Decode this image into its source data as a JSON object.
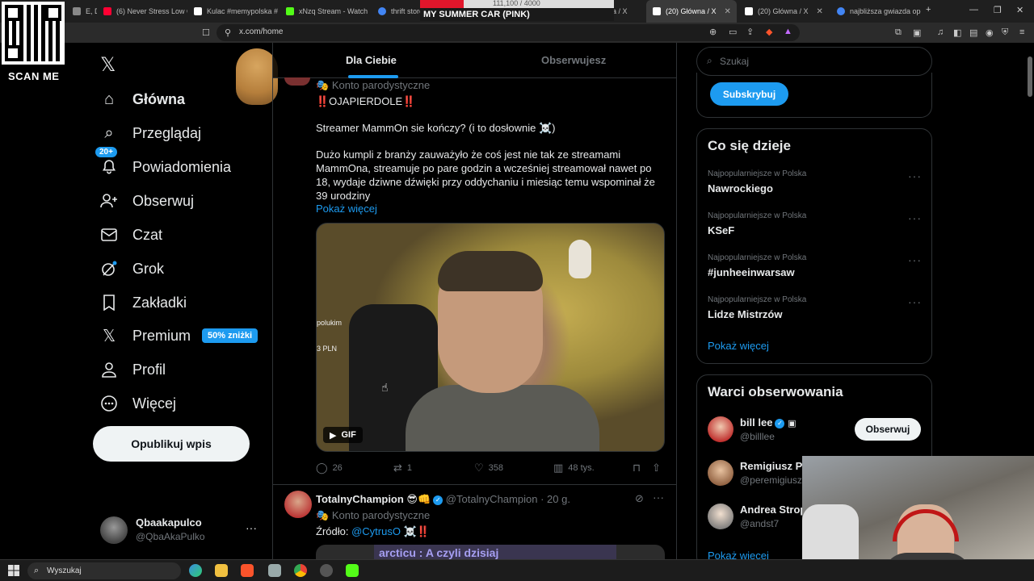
{
  "browser": {
    "tabs": [
      {
        "label": "E, D-",
        "color": "#888888"
      },
      {
        "label": "(6) Never Stress Low C",
        "color": "#ff0033"
      },
      {
        "label": "Kulac #memypolska #",
        "color": "#ffffff"
      },
      {
        "label": "xNzq Stream - Watch",
        "color": "#53fc18"
      },
      {
        "label": "thrift stores",
        "color": "#4285f4"
      },
      {
        "label": "(20) Główna / X",
        "color": "#ffffff"
      },
      {
        "label": "(20) Główna / X",
        "color": "#ffffff"
      },
      {
        "label": "(20) Główna / X",
        "color": "#ffffff"
      },
      {
        "label": "najbliższa gwiazda ope",
        "color": "#4285f4"
      }
    ],
    "new_tab": "+",
    "url": "x.com/home"
  },
  "overlays": {
    "scan_me": "SCAN ME",
    "progress_text": "111,100 / 4000",
    "stream_title": "MY SUMMER CAR (PINK)"
  },
  "nav": {
    "items": [
      {
        "label": "Główna",
        "icon": "home-icon",
        "glyph": "⌂"
      },
      {
        "label": "Przeglądaj",
        "icon": "search-icon",
        "glyph": "⌕"
      },
      {
        "label": "Powiadomienia",
        "icon": "bell-icon",
        "glyph": "🔔"
      },
      {
        "label": "Obserwuj",
        "icon": "add-person-icon",
        "glyph": "👤"
      },
      {
        "label": "Czat",
        "icon": "mail-icon",
        "glyph": "✉"
      },
      {
        "label": "Grok",
        "icon": "grok-icon",
        "glyph": "⊘"
      },
      {
        "label": "Zakładki",
        "icon": "bookmark-icon",
        "glyph": "🔖"
      },
      {
        "label": "Premium",
        "icon": "x-logo-icon",
        "glyph": "𝕏"
      },
      {
        "label": "Profil",
        "icon": "person-icon",
        "glyph": "👤"
      },
      {
        "label": "Więcej",
        "icon": "more-circle-icon",
        "glyph": "⋯"
      }
    ],
    "notif_badge": "20+",
    "premium_badge": "50% zniżki",
    "post_button": "Opublikuj wpis",
    "account": {
      "name": "Qbaakapulco",
      "handle": "@QbaAkaPulko",
      "more": "···"
    }
  },
  "timeline": {
    "tab_for_you": "Dla Ciebie",
    "tab_following": "Obserwujesz",
    "post1": {
      "parody_label": "Konto parodystyczne",
      "line1": "‼️OJAPIERDOLE‼️",
      "line2": "Streamer MammOn sie kończy? (i to dosłownie ☠️)",
      "body": "Dużo kumpli z branży zauważyło że coś jest nie tak ze streamami MammOna, streamuje po pare godzin a wcześniej streamował nawet po 18, wydaje dziwne dźwięki przy oddychaniu i miesiąc temu wspominał że 39 urodziny",
      "show_more": "Pokaż więcej",
      "media_overlay_1": "polukim",
      "media_overlay_2": "3 PLN",
      "gif_label": "GIF",
      "replies": "26",
      "reposts": "1",
      "likes": "358",
      "views": "48 tys."
    },
    "post2": {
      "name": "TotalnyChampion 😎👊",
      "handle": "@TotalnyChampion",
      "time": "· 20 g.",
      "parody_label": "Konto parodystyczne",
      "source_prefix": "Źródło: ",
      "source_link": "@CytrusO",
      "source_suffix": " ☠️‼️",
      "preview_text": "arcticu  : A czyli dzisiaj"
    }
  },
  "sidebar": {
    "search_placeholder": "Szukaj",
    "subscribe": "Subskrybuj",
    "trends_title": "Co się dzieje",
    "trends": [
      {
        "meta": "Najpopularniejsze w Polska",
        "name": "Nawrockiego"
      },
      {
        "meta": "Najpopularniejsze w Polska",
        "name": "KSeF"
      },
      {
        "meta": "Najpopularniejsze w Polska",
        "name": "#junheeinwarsaw"
      },
      {
        "meta": "Najpopularniejsze w Polska",
        "name": "Lidze Mistrzów"
      }
    ],
    "trends_more": "Pokaż więcej",
    "wtf_title": "Warci obserwowania",
    "wtf": [
      {
        "name": "bill lee",
        "handle": "@billlee"
      },
      {
        "name": "Remigiusz Pu",
        "handle": "@peremigiusz"
      },
      {
        "name": "Andrea Strop",
        "handle": "@andst7"
      }
    ],
    "follow_button": "Obserwuj",
    "wtf_more": "Pokaż więcej"
  },
  "taskbar": {
    "search": "Wyszukaj"
  }
}
